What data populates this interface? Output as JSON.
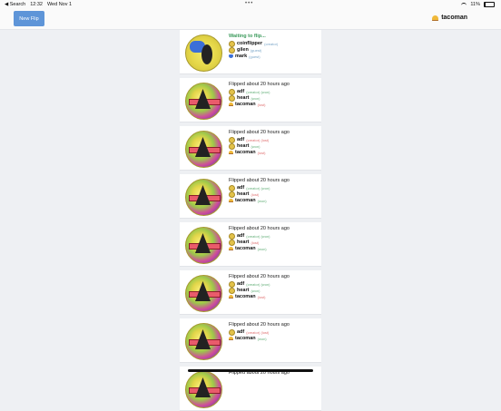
{
  "status_bar": {
    "back_label": "◀ Search",
    "time": "12:32",
    "date": "Wed Nov 1",
    "dots": "•••",
    "battery_pct": "11%"
  },
  "toolbar": {
    "new_flip_label": "New Flip",
    "brand_label": "tacoman"
  },
  "cards": [
    {
      "heading": "Waiting to flip...",
      "variant": "wait",
      "players": [
        {
          "name": "coinflipper",
          "tag": "(creator)",
          "tag_class": "t-creator",
          "icon": "avatar-icon"
        },
        {
          "name": "gilen",
          "tag": "(guest)",
          "tag_class": "t-guest",
          "icon": "avatar-icon"
        },
        {
          "name": "mark",
          "tag": "(guest)",
          "tag_class": "t-guest",
          "icon": "heart-icon"
        }
      ]
    },
    {
      "heading": "Flipped about 20 hours ago",
      "players": [
        {
          "name": "adf",
          "tag": "(creator) (won)",
          "tag_class": "t-won",
          "icon": "avatar-icon"
        },
        {
          "name": "heart",
          "tag": "(won)",
          "tag_class": "t-won",
          "icon": "avatar-icon"
        },
        {
          "name": "tacoman",
          "tag": "(lost)",
          "tag_class": "t-lost",
          "icon": "taco-icon"
        }
      ]
    },
    {
      "heading": "Flipped about 20 hours ago",
      "players": [
        {
          "name": "adf",
          "tag": "(creator) (lost)",
          "tag_class": "t-lost",
          "icon": "avatar-icon"
        },
        {
          "name": "heart",
          "tag": "(won)",
          "tag_class": "t-won",
          "icon": "avatar-icon"
        },
        {
          "name": "tacoman",
          "tag": "(lost)",
          "tag_class": "t-lost",
          "icon": "taco-icon"
        }
      ]
    },
    {
      "heading": "Flipped about 20 hours ago",
      "players": [
        {
          "name": "adf",
          "tag": "(creator) (won)",
          "tag_class": "t-won",
          "icon": "avatar-icon"
        },
        {
          "name": "heart",
          "tag": "(lost)",
          "tag_class": "t-lost",
          "icon": "avatar-icon"
        },
        {
          "name": "tacoman",
          "tag": "(won)",
          "tag_class": "t-won",
          "icon": "taco-icon"
        }
      ]
    },
    {
      "heading": "Flipped about 20 hours ago",
      "players": [
        {
          "name": "adf",
          "tag": "(creator) (won)",
          "tag_class": "t-won",
          "icon": "avatar-icon"
        },
        {
          "name": "heart",
          "tag": "(lost)",
          "tag_class": "t-lost",
          "icon": "avatar-icon"
        },
        {
          "name": "tacoman",
          "tag": "(won)",
          "tag_class": "t-won",
          "icon": "taco-icon"
        }
      ]
    },
    {
      "heading": "Flipped about 20 hours ago",
      "players": [
        {
          "name": "adf",
          "tag": "(creator) (won)",
          "tag_class": "t-won",
          "icon": "avatar-icon"
        },
        {
          "name": "heart",
          "tag": "(won)",
          "tag_class": "t-won",
          "icon": "avatar-icon"
        },
        {
          "name": "tacoman",
          "tag": "(lost)",
          "tag_class": "t-lost",
          "icon": "taco-icon"
        }
      ]
    },
    {
      "heading": "Flipped about 20 hours ago",
      "players": [
        {
          "name": "adf",
          "tag": "(creator) (lost)",
          "tag_class": "t-lost",
          "icon": "avatar-icon"
        },
        {
          "name": "tacoman",
          "tag": "(won)",
          "tag_class": "t-won",
          "icon": "taco-icon"
        }
      ]
    },
    {
      "heading": "Flipped about 20 hours ago",
      "players": []
    }
  ]
}
